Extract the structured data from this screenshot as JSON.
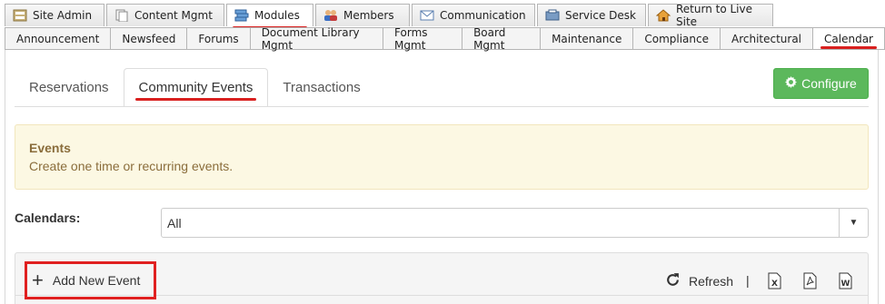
{
  "top_tabs": [
    {
      "label": "Site Admin",
      "icon": "site-admin-icon"
    },
    {
      "label": "Content Mgmt",
      "icon": "content-icon"
    },
    {
      "label": "Modules",
      "icon": "modules-icon",
      "active": true
    },
    {
      "label": "Members",
      "icon": "members-icon"
    },
    {
      "label": "Communication",
      "icon": "envelope-icon"
    },
    {
      "label": "Service Desk",
      "icon": "service-desk-icon"
    },
    {
      "label": "Return to Live Site",
      "icon": "home-icon"
    }
  ],
  "sub_tabs": [
    "Announcement",
    "Newsfeed",
    "Forums",
    "Document Library Mgmt",
    "Forms Mgmt",
    "Board Mgmt",
    "Maintenance",
    "Compliance",
    "Architectural",
    "Calendar"
  ],
  "content_tabs": [
    "Reservations",
    "Community Events",
    "Transactions"
  ],
  "configure_label": "Configure",
  "notice": {
    "title": "Events",
    "description": "Create one time or recurring events."
  },
  "calendars": {
    "label": "Calendars:",
    "selected": "All"
  },
  "toolbar": {
    "add_label": "Add New Event",
    "refresh_label": "Refresh",
    "separator": "|"
  },
  "colors": {
    "accent_red": "#d9201f",
    "configure_green": "#5cb85c",
    "notice_bg": "#fcf8e3",
    "notice_text": "#8a6d3b"
  }
}
